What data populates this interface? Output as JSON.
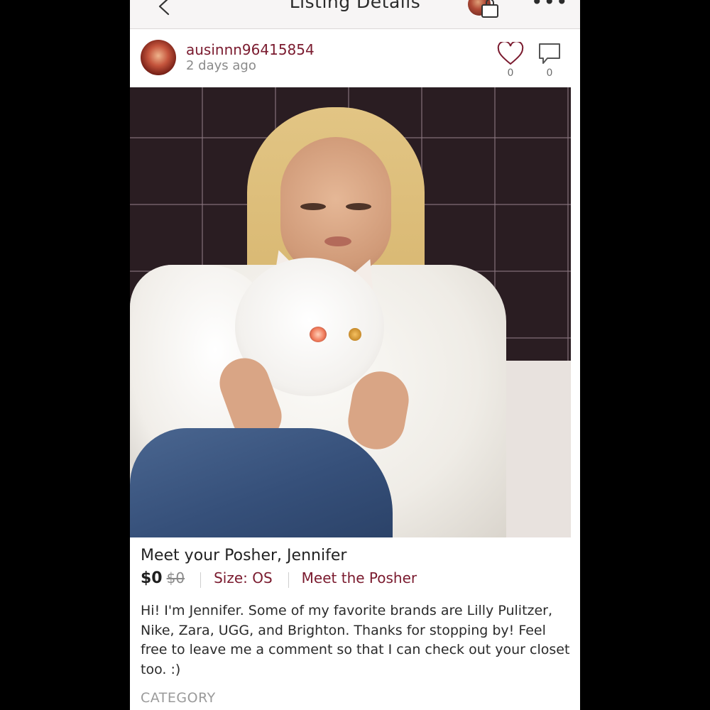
{
  "header": {
    "title": "Listing Details",
    "more_label": "•••"
  },
  "seller": {
    "username": "ausinnn96415854",
    "time_ago": "2 days ago",
    "likes": "0",
    "comments": "0"
  },
  "listing": {
    "title": "Meet your Posher, Jennifer",
    "price": "$0",
    "original_price": "$0",
    "size": "Size: OS",
    "meet_link": "Meet the Posher",
    "description": "Hi! I'm Jennifer. Some of my favorite brands are Lilly Pulitzer, Nike, Zara, UGG, and Brighton. Thanks for stopping by! Feel free to leave me a comment so that I can check out your closet too. :)",
    "category_label": "CATEGORY"
  },
  "icons": {
    "back": "chevron-left-icon",
    "cart": "shopping-bag-icon",
    "more": "more-icon",
    "like": "heart-icon",
    "comment": "comment-icon"
  },
  "colors": {
    "accent": "#7a1a2e",
    "background": "#000000"
  }
}
